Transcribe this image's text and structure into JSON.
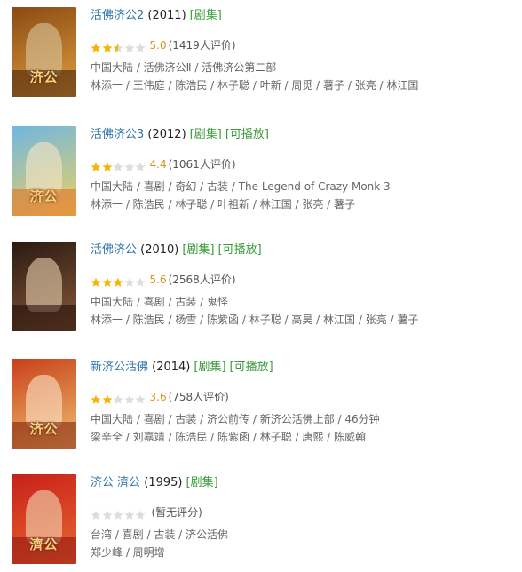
{
  "results": [
    {
      "title": "活佛济公2",
      "year": "(2011)",
      "tags": [
        "[剧集]"
      ],
      "rating": 5.0,
      "score_text": "5.0",
      "votes_text": "(1419人评价)",
      "meta": "中国大陆 / 活佛济公Ⅱ / 活佛济公第二部",
      "cast": "林添一 / 王伟庭 / 陈浩民 / 林子聪 / 叶新 / 周觅 / 薯子 / 张亮 / 林江国",
      "poster": {
        "bg1": "#8a4a12",
        "bg2": "#e0a040",
        "band": "#3a1a08",
        "figure": "#d9c7a0",
        "logo": "济公"
      }
    },
    {
      "title": "活佛济公3",
      "year": "(2012)",
      "tags": [
        "[剧集]",
        "[可播放]"
      ],
      "rating": 4.4,
      "score_text": "4.4",
      "votes_text": "(1061人评价)",
      "meta": "中国大陆 / 喜剧 / 奇幻 / 古装 / The Legend of Crazy Monk 3",
      "cast": "林添一 / 陈浩民 / 林子聪 / 叶祖新 / 林江国 / 张亮 / 薯子",
      "poster": {
        "bg1": "#6fb7e0",
        "bg2": "#f0d060",
        "band": "#e06a20",
        "figure": "#f7e6c6",
        "logo": "济公"
      }
    },
    {
      "title": "活佛济公",
      "year": "(2010)",
      "tags": [
        "[剧集]",
        "[可播放]"
      ],
      "rating": 5.6,
      "score_text": "5.6",
      "votes_text": "(2568人评价)",
      "meta": "中国大陆 / 喜剧 / 古装 / 鬼怪",
      "cast": "林添一 / 陈浩民 / 杨雪 / 陈紫函 / 林子聪 / 高昊 / 林江国 / 张亮 / 薯子",
      "poster": {
        "bg1": "#2a1a12",
        "bg2": "#8a5a3a",
        "band": "#1a0a05",
        "figure": "#e8d0b0",
        "logo": ""
      }
    },
    {
      "title": "新济公活佛",
      "year": "(2014)",
      "tags": [
        "[剧集]",
        "[可播放]"
      ],
      "rating": 3.6,
      "score_text": "3.6",
      "votes_text": "(758人评价)",
      "meta": "中国大陆 / 喜剧 / 古装 / 济公前传 / 新济公活佛上部 / 46分钟",
      "cast": "梁辛全 / 刘嘉靖 / 陈浩民 / 陈紫函 / 林子聪 / 唐熙 / 陈威翰",
      "poster": {
        "bg1": "#c8401a",
        "bg2": "#f0c070",
        "band": "#7a1a08",
        "figure": "#fbe3c9",
        "logo": "济公"
      }
    },
    {
      "title": "济公 濟公",
      "year": "(1995)",
      "tags": [
        "[剧集]"
      ],
      "rating": 0,
      "score_text": "",
      "votes_text": "(暂无评分)",
      "meta": "台湾 / 喜剧 / 古装 / 济公活佛",
      "cast": "郑少峰 / 周明增",
      "poster": {
        "bg1": "#c8201a",
        "bg2": "#e86a30",
        "band": "#8a1010",
        "figure": "#f0d8b8",
        "logo": "濟公"
      }
    }
  ]
}
